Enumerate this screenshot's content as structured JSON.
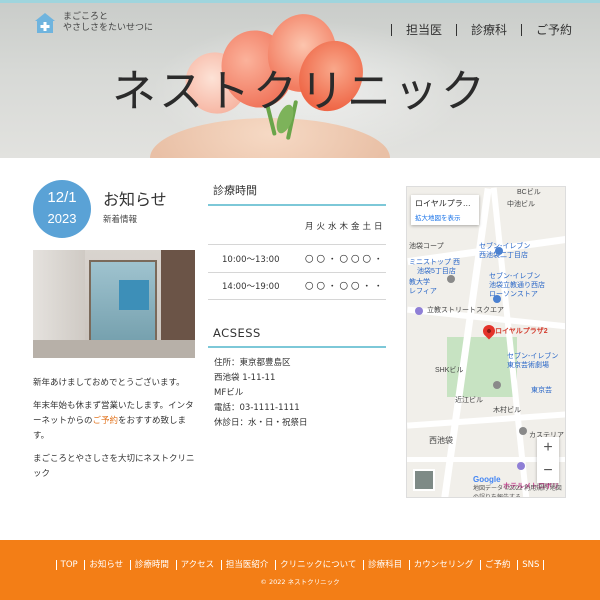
{
  "header": {
    "logo_line1": "まごころと",
    "logo_line2": "やさしさをたいせつに",
    "nav": [
      "担当医",
      "診療科",
      "ご予約"
    ],
    "title": "ネストクリニック"
  },
  "news": {
    "date_day": "12/1",
    "date_year": "2023",
    "title": "お知らせ",
    "subtitle": "新着情報",
    "p1": "新年あけましておめでとうございます。",
    "p2a": "年末年始も休まず営業いたします。インターネットからの",
    "p2link": "ご予約",
    "p2b": "をおすすめ致します。",
    "p3": "まごころとやさしさを大切にネストクリニック"
  },
  "hours": {
    "heading": "診療時間",
    "days": [
      "月",
      "火",
      "水",
      "木",
      "金",
      "土",
      "日"
    ],
    "rows": [
      {
        "time": "10:00～13:00",
        "marks": [
          "〇",
          "〇",
          "・",
          "〇",
          "〇",
          "〇",
          "・"
        ]
      },
      {
        "time": "14:00～19:00",
        "marks": [
          "〇",
          "〇",
          "・",
          "〇",
          "〇",
          "・",
          "・"
        ]
      }
    ]
  },
  "access": {
    "heading": "ACSESS",
    "lines": [
      "住所：東京都豊島区",
      "西池袋 1-11-11",
      "MFビル",
      "電話：03-1111-1111",
      "休診日：水・日・祝祭日"
    ]
  },
  "map": {
    "place_name": "ロイヤルプラ…",
    "enlarge_link": "拡大地図を表示",
    "labels": {
      "station_bc": "BCビル",
      "nakaike": "中池ビル",
      "coop": "池袋コープ",
      "seven1": "セブン-イレブン",
      "seven1b": "西池袋二丁目店",
      "ministop": "ミニストップ 西",
      "ministop2": "池袋5丁目店",
      "ikebukuro": "セブン-イレブン",
      "ikebukuro2": "池袋立教通り西店",
      "lawson": "ローソンストア",
      "rikkyo": "教大学",
      "rikkyo2": "レフィア",
      "street": "立教ストリートスクエア",
      "target": "ロイヤルプラザ2",
      "seven3": "セブン-イレブン",
      "seven3b": "東京芸術劇場",
      "shk": "SHKビル",
      "omiya": "近江ビル",
      "geigeki": "東京芸",
      "kimura": "木村ビル",
      "castle": "カステリア",
      "nishi": "西池袋",
      "hotel": "ホテルメトロポリ",
      "copyright": "地図データ ©2022 利用規約 地図の誤りを報告する",
      "google": "Google"
    },
    "zoom_in": "+",
    "zoom_out": "−"
  },
  "footer": {
    "links": [
      "TOP",
      "お知らせ",
      "診療時間",
      "アクセス",
      "担当医紹介",
      "クリニックについて",
      "診療科目",
      "カウンセリング",
      "ご予約",
      "SNS"
    ],
    "copyright": "© 2022 ネストクリニック"
  },
  "colors": {
    "accent_blue": "#5aa2d6",
    "line_teal": "#7dc8d8",
    "footer_orange": "#f37e16",
    "link_orange": "#e2741f"
  }
}
